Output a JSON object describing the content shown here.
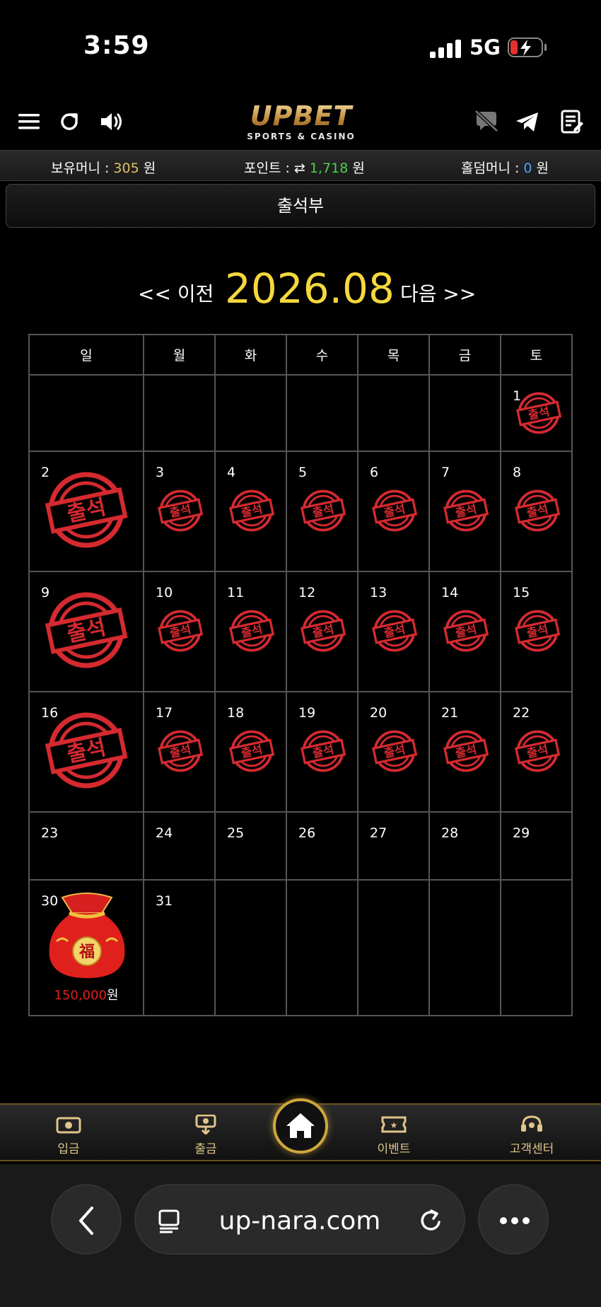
{
  "status": {
    "time": "3:59",
    "network": "5G"
  },
  "header": {
    "logo_main": "UPBET",
    "logo_sub": "SPORTS & CASINO"
  },
  "money": {
    "held_label": "보유머니 : ",
    "held_value": "305",
    "held_unit": " 원",
    "point_label": "포인트 : ",
    "point_value": "1,718",
    "point_unit": " 원",
    "holdem_label": "홀덤머니 : ",
    "holdem_value": "0",
    "holdem_unit": " 원"
  },
  "page_title": "출석부",
  "nav": {
    "prev": "<< 이전",
    "month": "2026.08",
    "next": "다음 >>"
  },
  "weekdays": [
    "일",
    "월",
    "화",
    "수",
    "목",
    "금",
    "토"
  ],
  "stamp_text": "출석",
  "weeks": [
    [
      null,
      null,
      null,
      null,
      null,
      null,
      {
        "day": "1",
        "stamp": true
      }
    ],
    [
      {
        "day": "2",
        "stamp": true
      },
      {
        "day": "3",
        "stamp": true
      },
      {
        "day": "4",
        "stamp": true
      },
      {
        "day": "5",
        "stamp": true
      },
      {
        "day": "6",
        "stamp": true
      },
      {
        "day": "7",
        "stamp": true
      },
      {
        "day": "8",
        "stamp": true
      }
    ],
    [
      {
        "day": "9",
        "stamp": true
      },
      {
        "day": "10",
        "stamp": true
      },
      {
        "day": "11",
        "stamp": true
      },
      {
        "day": "12",
        "stamp": true
      },
      {
        "day": "13",
        "stamp": true
      },
      {
        "day": "14",
        "stamp": true
      },
      {
        "day": "15",
        "stamp": true
      }
    ],
    [
      {
        "day": "16",
        "stamp": true
      },
      {
        "day": "17",
        "stamp": true
      },
      {
        "day": "18",
        "stamp": true
      },
      {
        "day": "19",
        "stamp": true
      },
      {
        "day": "20",
        "stamp": true
      },
      {
        "day": "21",
        "stamp": true
      },
      {
        "day": "22",
        "stamp": true
      }
    ],
    [
      {
        "day": "23"
      },
      {
        "day": "24"
      },
      {
        "day": "25"
      },
      {
        "day": "26"
      },
      {
        "day": "27"
      },
      {
        "day": "28"
      },
      {
        "day": "29"
      }
    ],
    [
      {
        "day": "30",
        "prize_amount": "150,000",
        "prize_unit": "원"
      },
      {
        "day": "31"
      },
      null,
      null,
      null,
      null,
      null
    ]
  ],
  "bottom_nav": {
    "deposit": "입금",
    "withdraw": "출금",
    "event": "이벤트",
    "support": "고객센터"
  },
  "browser": {
    "url": "up-nara.com"
  },
  "colors": {
    "gold": "#e0c060",
    "green": "#4cd04c",
    "blue": "#4aa0ff",
    "stamp_red": "#d42a30",
    "month_yellow": "#f5d83c"
  }
}
